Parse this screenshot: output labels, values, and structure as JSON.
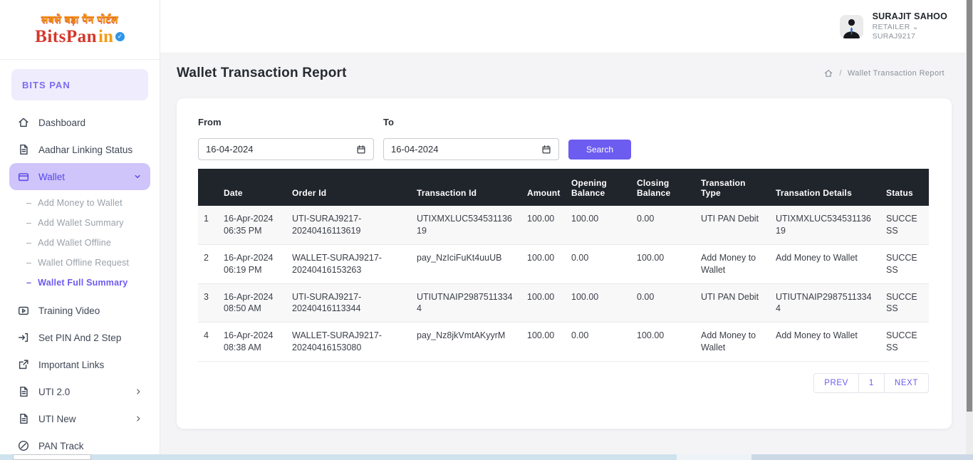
{
  "brand": {
    "tagline": "सबसे बड़ा पैन पोर्टल",
    "name": "BitsPan",
    "suffix": "in",
    "section_label": "BITS PAN"
  },
  "header": {
    "user_name": "SURAJIT SAHOO",
    "user_role": "RETAILER ⌄",
    "user_id": "SURAJ9217"
  },
  "page": {
    "title": "Wallet Transaction Report",
    "breadcrumb_separator": "/",
    "breadcrumb_current": "Wallet Transaction Report"
  },
  "sidebar": {
    "submenu_bullet": "–",
    "items": [
      {
        "label": "Dashboard",
        "icon": "home-icon"
      },
      {
        "label": "Aadhar Linking Status",
        "icon": "file-text-icon"
      },
      {
        "label": "Wallet",
        "icon": "wallet-icon",
        "active": true
      },
      {
        "label": "Training Video",
        "icon": "video-icon"
      },
      {
        "label": "Set PIN And 2 Step",
        "icon": "login-icon"
      },
      {
        "label": "Important Links",
        "icon": "external-link-icon"
      },
      {
        "label": "UTI 2.0",
        "icon": "file-icon"
      },
      {
        "label": "UTI New",
        "icon": "file-icon"
      },
      {
        "label": "PAN Track",
        "icon": "compass-icon"
      }
    ],
    "wallet_submenu": [
      {
        "label": "Add Money to Wallet"
      },
      {
        "label": "Add Wallet Summary"
      },
      {
        "label": "Add Wallet Offline"
      },
      {
        "label": "Wallet Offline Request"
      },
      {
        "label": "Wallet Full Summary",
        "active": true
      }
    ]
  },
  "filters": {
    "from_label": "From",
    "to_label": "To",
    "from_value": "16-04-2024",
    "to_value": "16-04-2024",
    "search_label": "Search"
  },
  "table": {
    "headers": [
      "",
      "Date",
      "Order Id",
      "Transaction Id",
      "Amount",
      "Opening Balance",
      "Closing Balance",
      "Transation Type",
      "Transation Details",
      "Status"
    ],
    "rows": [
      {
        "sno": "1",
        "date": "16-Apr-2024",
        "time": "06:35 PM",
        "order_id": "UTI-SURAJ9217-20240416113619",
        "transaction_id": "UTIXMXLUC53453113619",
        "amount": "100.00",
        "opening_balance": "100.00",
        "closing_balance": "0.00",
        "transation_type": "UTI PAN Debit",
        "transation_details": "UTIXMXLUC53453113619",
        "status": "SUCCESS"
      },
      {
        "sno": "2",
        "date": "16-Apr-2024",
        "time": "06:19 PM",
        "order_id": "WALLET-SURAJ9217-20240416153263",
        "transaction_id": "pay_NzIciFuKt4uuUB",
        "amount": "100.00",
        "opening_balance": "0.00",
        "closing_balance": "100.00",
        "transation_type": "Add Money to Wallet",
        "transation_details": "Add Money to Wallet",
        "status": "SUCCESS"
      },
      {
        "sno": "3",
        "date": "16-Apr-2024",
        "time": "08:50 AM",
        "order_id": "UTI-SURAJ9217-20240416113344",
        "transaction_id": "UTIUTNAIP29875113344",
        "amount": "100.00",
        "opening_balance": "100.00",
        "closing_balance": "0.00",
        "transation_type": "UTI PAN Debit",
        "transation_details": "UTIUTNAIP29875113344",
        "status": "SUCCESS"
      },
      {
        "sno": "4",
        "date": "16-Apr-2024",
        "time": "08:38 AM",
        "order_id": "WALLET-SURAJ9217-20240416153080",
        "transaction_id": "pay_Nz8jkVmtAKyyrM",
        "amount": "100.00",
        "opening_balance": "0.00",
        "closing_balance": "100.00",
        "transation_type": "Add Money to Wallet",
        "transation_details": "Add Money to Wallet",
        "status": "SUCCESS"
      }
    ]
  },
  "pagination": {
    "prev": "PREV",
    "page": "1",
    "next": "NEXT"
  },
  "colors": {
    "accent": "#6d5cf0",
    "accent_light": "#cfc5fa",
    "accent_pale": "#efecfd",
    "table_header_bg": "#20242b"
  }
}
